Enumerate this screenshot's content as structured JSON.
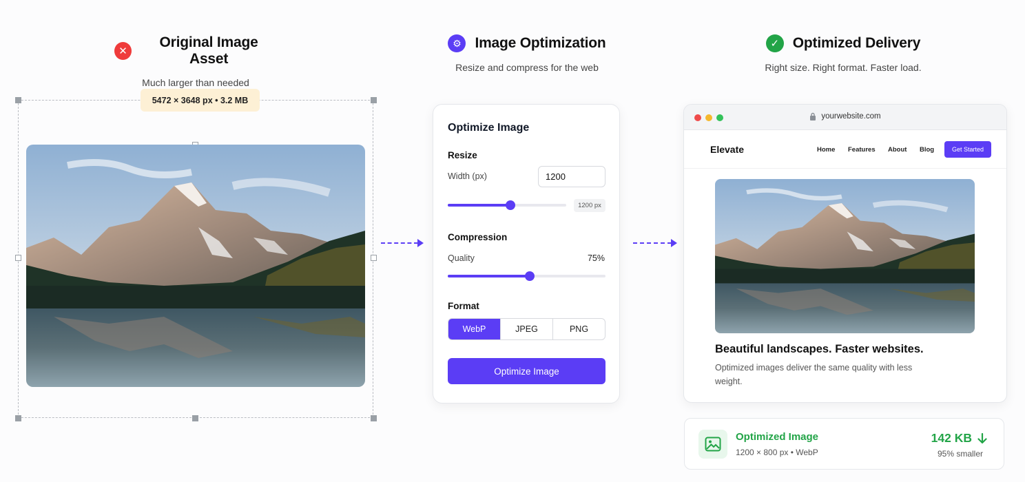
{
  "colors": {
    "accent": "#5b3df5",
    "error": "#ef3b3b",
    "success": "#22a447"
  },
  "original": {
    "title": "Original Image Asset",
    "subtitle": "Much larger than needed",
    "status_icon": "x-circle-icon",
    "dimensions_label": "5472 × 3648 px  •  3.2 MB"
  },
  "optimization": {
    "title": "Image Optimization",
    "subtitle": "Resize and compress for the web",
    "status_icon": "gear-icon",
    "panel": {
      "title": "Optimize Image",
      "resize_label": "Resize",
      "width_label": "Width (px)",
      "width_value": "1200",
      "width_slider_fraction": 0.53,
      "width_chip": "1200 px",
      "compression_label": "Compression",
      "quality_label": "Quality",
      "quality_value": "75%",
      "quality_fraction": 0.52,
      "format_label": "Format",
      "formats": [
        "WebP",
        "JPEG",
        "PNG"
      ],
      "selected_format": "WebP",
      "button_label": "Optimize Image"
    }
  },
  "delivery": {
    "title": "Optimized Delivery",
    "subtitle": "Right size. Right format. Faster load.",
    "status_icon": "check-circle-icon",
    "browser": {
      "url": "yourwebsite.com",
      "brand": "Elevate",
      "nav": [
        "Home",
        "Features",
        "About",
        "Blog"
      ],
      "cta": "Get Started",
      "headline": "Beautiful landscapes. Faster websites.",
      "body": "Optimized images deliver the same quality with less weight."
    },
    "result": {
      "title": "Optimized Image",
      "meta": "1200 × 800 px  •  WebP",
      "size": "142 KB",
      "reduction": "95% smaller"
    }
  }
}
